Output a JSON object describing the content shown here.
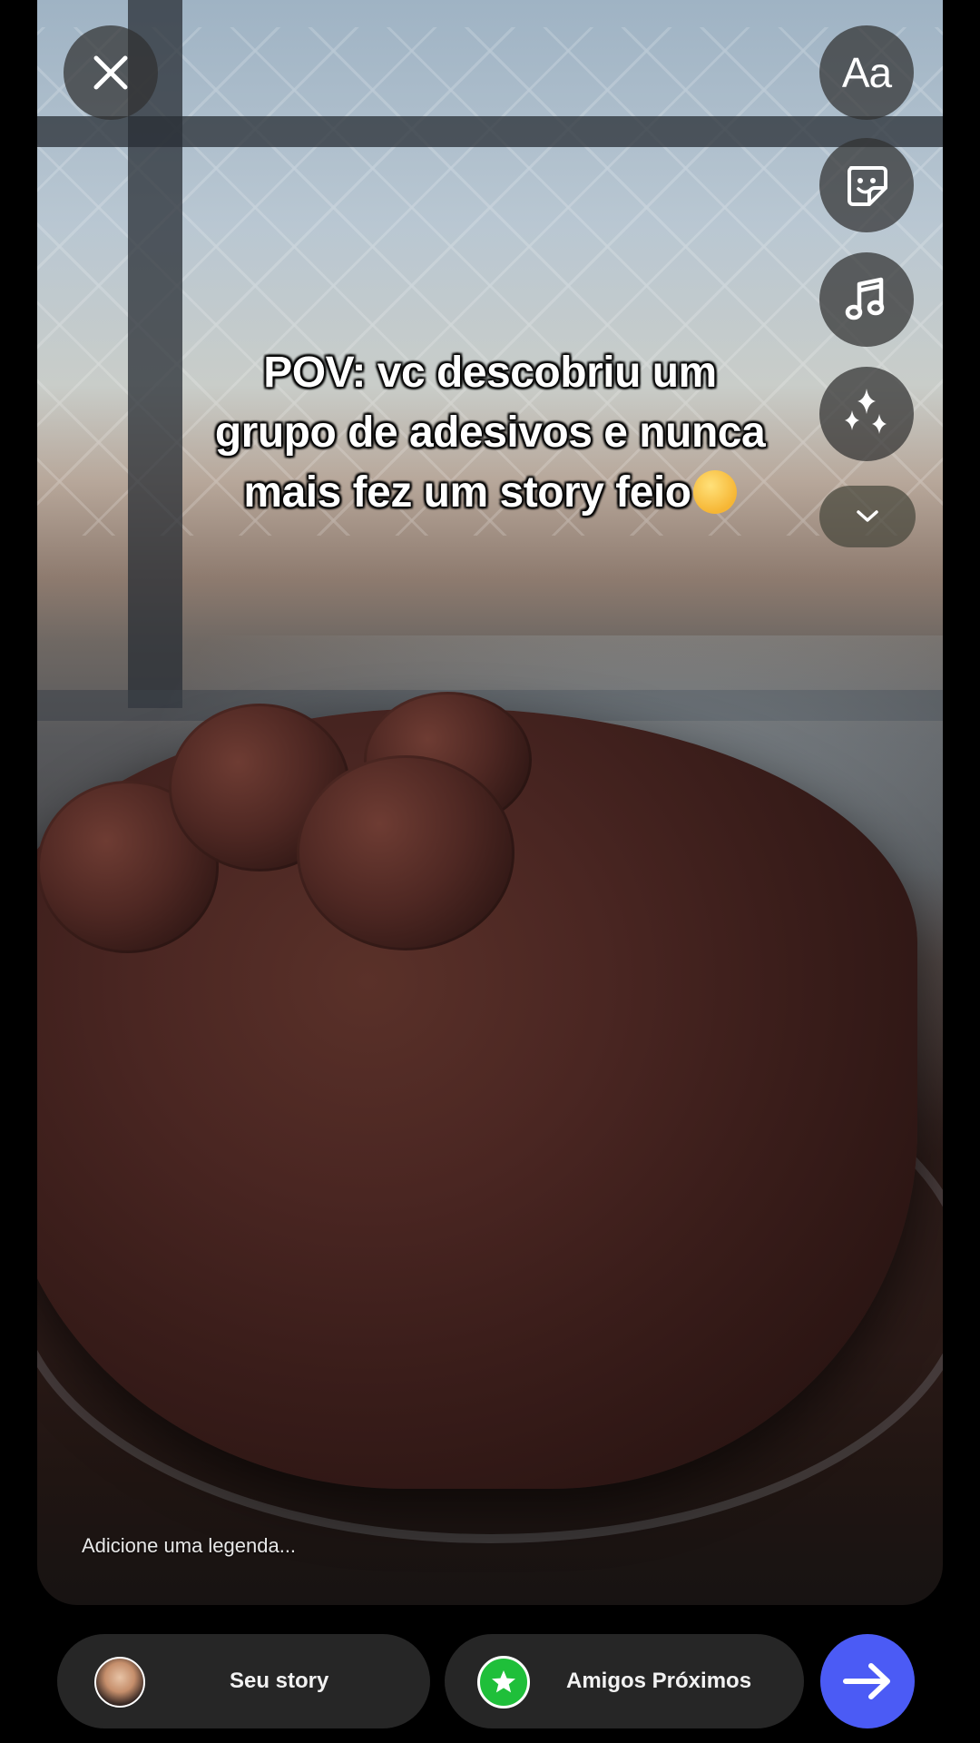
{
  "editor": {
    "overlay_text_lines": [
      "POV: vc descobriu um",
      "grupo de adesivos e nunca",
      "mais fez um story feio"
    ],
    "overlay_emoji_icon": "tired-face-emoji",
    "caption_placeholder": "Adicione uma legenda..."
  },
  "toolbar": {
    "text_tool_label": "Aa",
    "icons": [
      "close-icon",
      "sticker-icon",
      "music-note-icon",
      "sparkles-icon",
      "chevron-down-icon"
    ]
  },
  "share": {
    "your_story_label": "Seu story",
    "close_friends_label": "Amigos Próximos",
    "send_icon": "arrow-right-icon",
    "colors": {
      "close_friends": "#1fbf3a",
      "send": "#4b5bf5",
      "pill_bg": "#262626"
    }
  }
}
